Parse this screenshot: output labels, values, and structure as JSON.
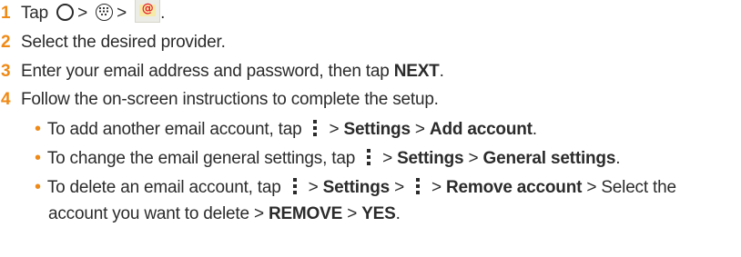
{
  "steps": [
    {
      "number": "1",
      "tap": "Tap",
      "sep1": ">",
      "sep2": ">",
      "end": "."
    },
    {
      "number": "2",
      "text": "Select the desired provider."
    },
    {
      "number": "3",
      "text_before": "Enter your email address and password, then tap ",
      "bold": "NEXT",
      "text_after": "."
    },
    {
      "number": "4",
      "text": "Follow the on-screen instructions to complete the setup."
    }
  ],
  "bullets": [
    {
      "before": "To add another email account, tap",
      "sep1": ">",
      "b1": "Settings",
      "sep2": ">",
      "b2": "Add account",
      "end": "."
    },
    {
      "before": "To change the email general settings, tap",
      "sep1": ">",
      "b1": "Settings",
      "sep2": ">",
      "b2": "General settings",
      "end": "."
    },
    {
      "before": "To delete an email account, tap",
      "sep1": ">",
      "b1": "Settings",
      "sep2": ">",
      "sep3": ">",
      "b2": "Remove account",
      "sep4": ">",
      "after": "Select the",
      "line2": "account you want to delete",
      "sep5": ">",
      "b3": "REMOVE",
      "sep6": ">",
      "b4": "YES",
      "end": "."
    }
  ],
  "icons": {
    "home": "home-circle-icon",
    "apps": "apps-icon",
    "email_app": "email-app-icon",
    "menu": "menu-dots-icon"
  },
  "colors": {
    "accent": "#ef8a17",
    "text": "#2b2b2b"
  }
}
